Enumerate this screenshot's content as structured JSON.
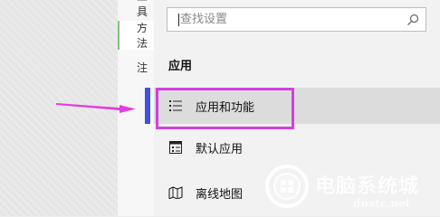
{
  "background_list": {
    "items": [
      {
        "label": "工具"
      },
      {
        "label": "方法"
      },
      {
        "label": "注"
      }
    ]
  },
  "settings": {
    "search": {
      "value": "",
      "placeholder": "查找设置"
    },
    "section_title": "应用",
    "items": [
      {
        "label": "应用和功能",
        "icon": "list-icon",
        "active": true
      },
      {
        "label": "默认应用",
        "icon": "default-apps-icon",
        "active": false
      },
      {
        "label": "离线地图",
        "icon": "map-icon",
        "active": false
      }
    ]
  },
  "watermark": {
    "text": "电脑系统城",
    "url": "dnxtc.net"
  },
  "colors": {
    "highlight": "#d040e0",
    "arrow": "#e040e0",
    "active_bar": "#4050e0"
  }
}
